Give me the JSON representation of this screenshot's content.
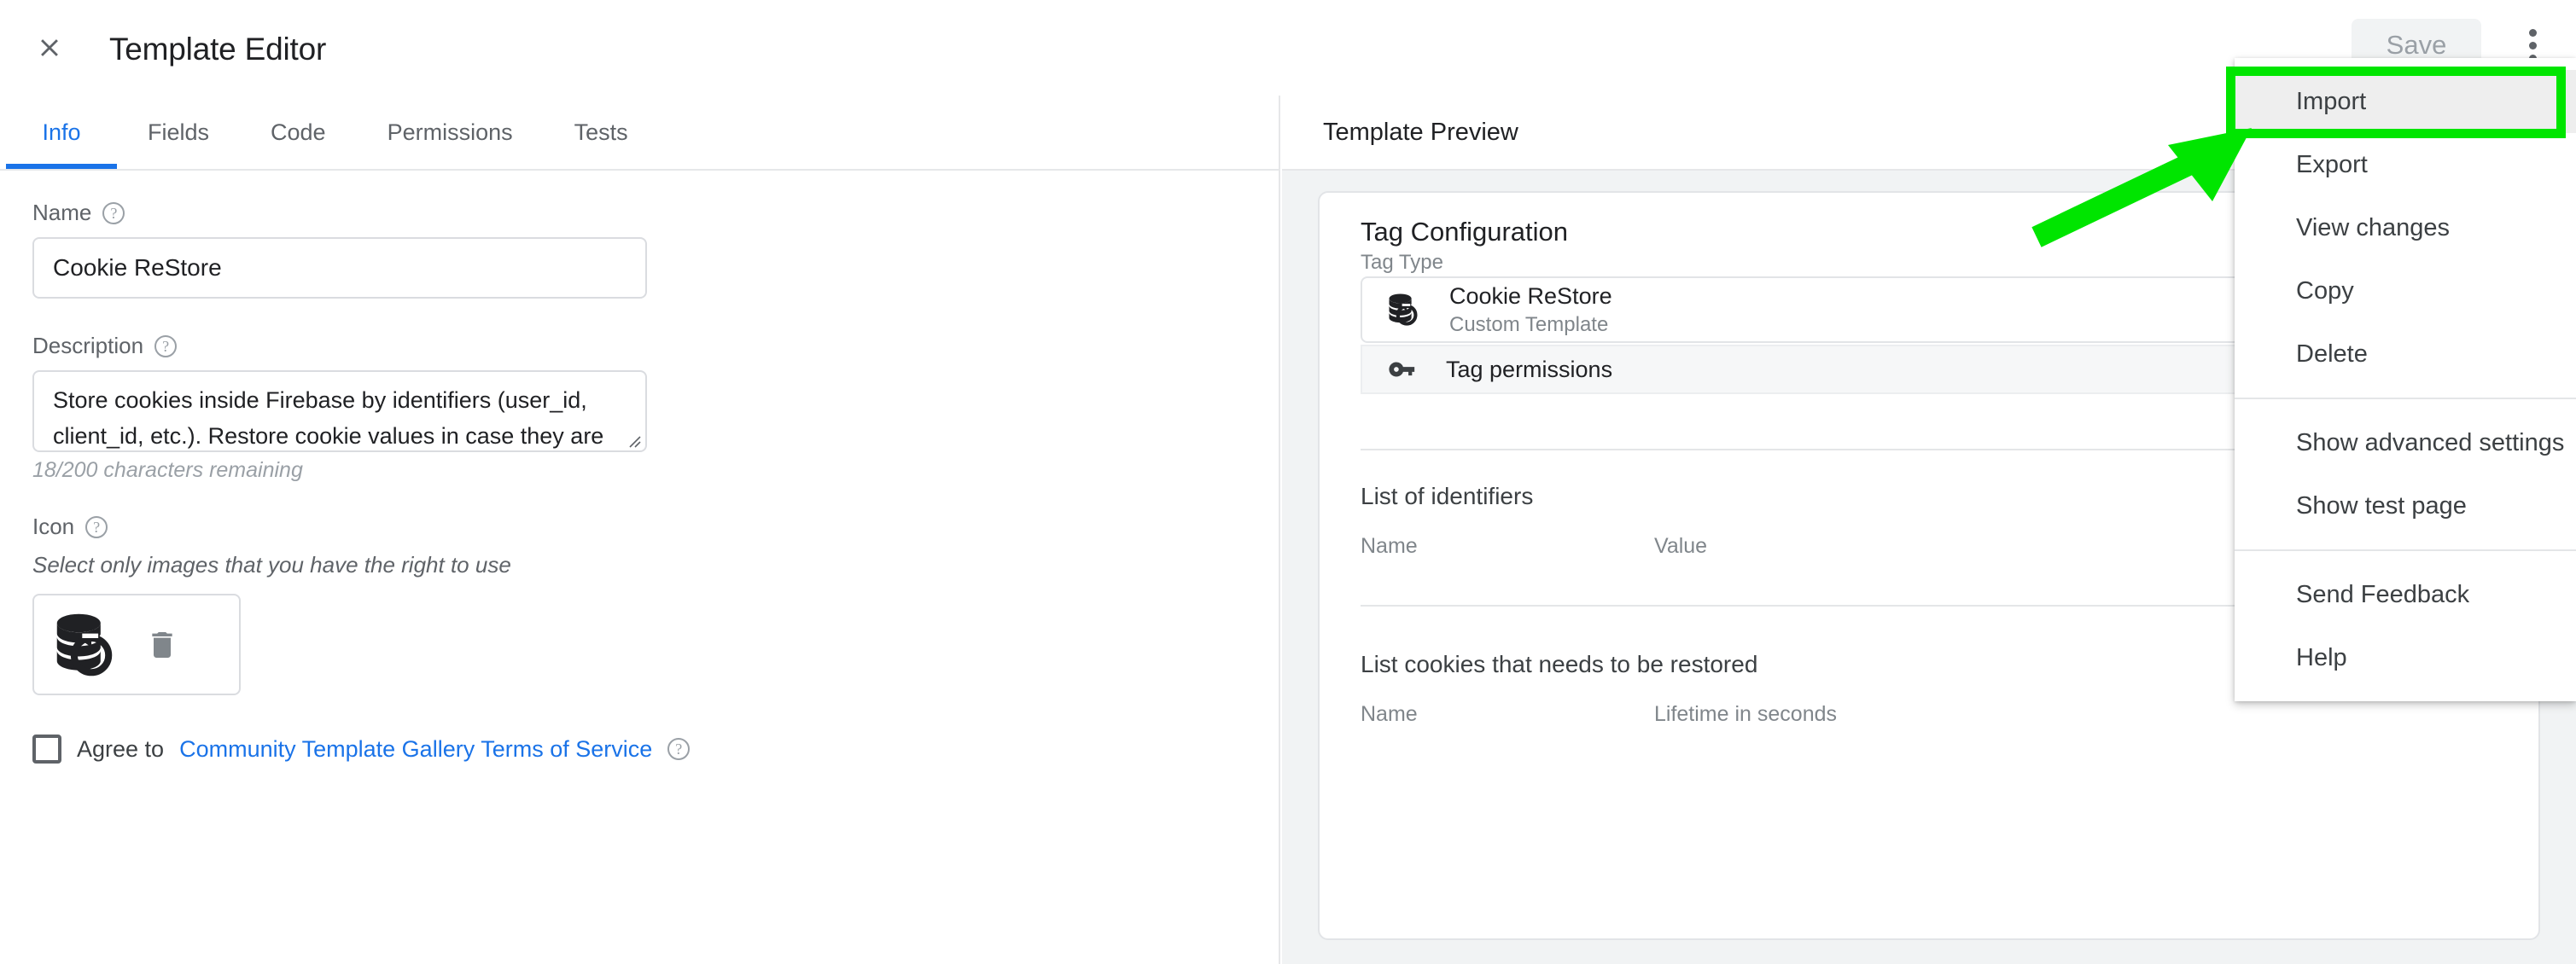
{
  "header": {
    "title": "Template Editor",
    "close_icon": "close-icon",
    "save_label": "Save",
    "kebab_icon": "more-vert-icon"
  },
  "tabs": [
    {
      "label": "Info",
      "active": true
    },
    {
      "label": "Fields",
      "active": false
    },
    {
      "label": "Code",
      "active": false
    },
    {
      "label": "Permissions",
      "active": false
    },
    {
      "label": "Tests",
      "active": false
    }
  ],
  "form": {
    "name_label": "Name",
    "name_value": "Cookie ReStore",
    "description_label": "Description",
    "description_value": "Store cookies inside Firebase by identifiers (user_id, client_id, etc.). Restore cookie values in case they are found by identifiers. Useful for cross-device and cross-site",
    "char_count": "18/200 characters remaining",
    "icon_label": "Icon",
    "icon_hint": "Select only images that you have the right to use",
    "icon_preview": "database-restore-icon",
    "delete_icon": "trash-icon",
    "agree_prefix": "Agree to",
    "agree_link": "Community Template Gallery Terms of Service",
    "help_icon": "help-circle-icon"
  },
  "preview": {
    "header_title": "Template Preview",
    "card_title": "Tag Configuration",
    "tag_type_label": "Tag Type",
    "tag_type_name": "Cookie ReStore",
    "tag_type_sub": "Custom Template",
    "tag_type_icon": "database-restore-icon",
    "tag_permissions_label": "Tag permissions",
    "tag_permissions_icon": "key-icon",
    "identifiers_title": "List of identifiers",
    "identifiers_col_name": "Name",
    "identifiers_col_value": "Value",
    "cookies_title": "List cookies that needs to be restored",
    "cookies_col_name": "Name",
    "cookies_col_lifetime": "Lifetime in seconds"
  },
  "menu": {
    "items": [
      {
        "label": "Import",
        "highlight": true
      },
      {
        "label": "Export",
        "highlight": false
      },
      {
        "label": "View changes",
        "highlight": false
      },
      {
        "label": "Copy",
        "highlight": false
      },
      {
        "label": "Delete",
        "highlight": false
      }
    ],
    "items2": [
      {
        "label": "Show advanced settings"
      },
      {
        "label": "Show test page"
      }
    ],
    "items3": [
      {
        "label": "Send Feedback"
      },
      {
        "label": "Help"
      }
    ]
  },
  "annotation": {
    "highlight_color": "#00e500",
    "arrow_color": "#00e500",
    "target": "Import"
  },
  "colors": {
    "accent": "#1a73e8",
    "text": "#202124",
    "muted": "#5f6368",
    "panel_bg": "#f1f3f4"
  }
}
